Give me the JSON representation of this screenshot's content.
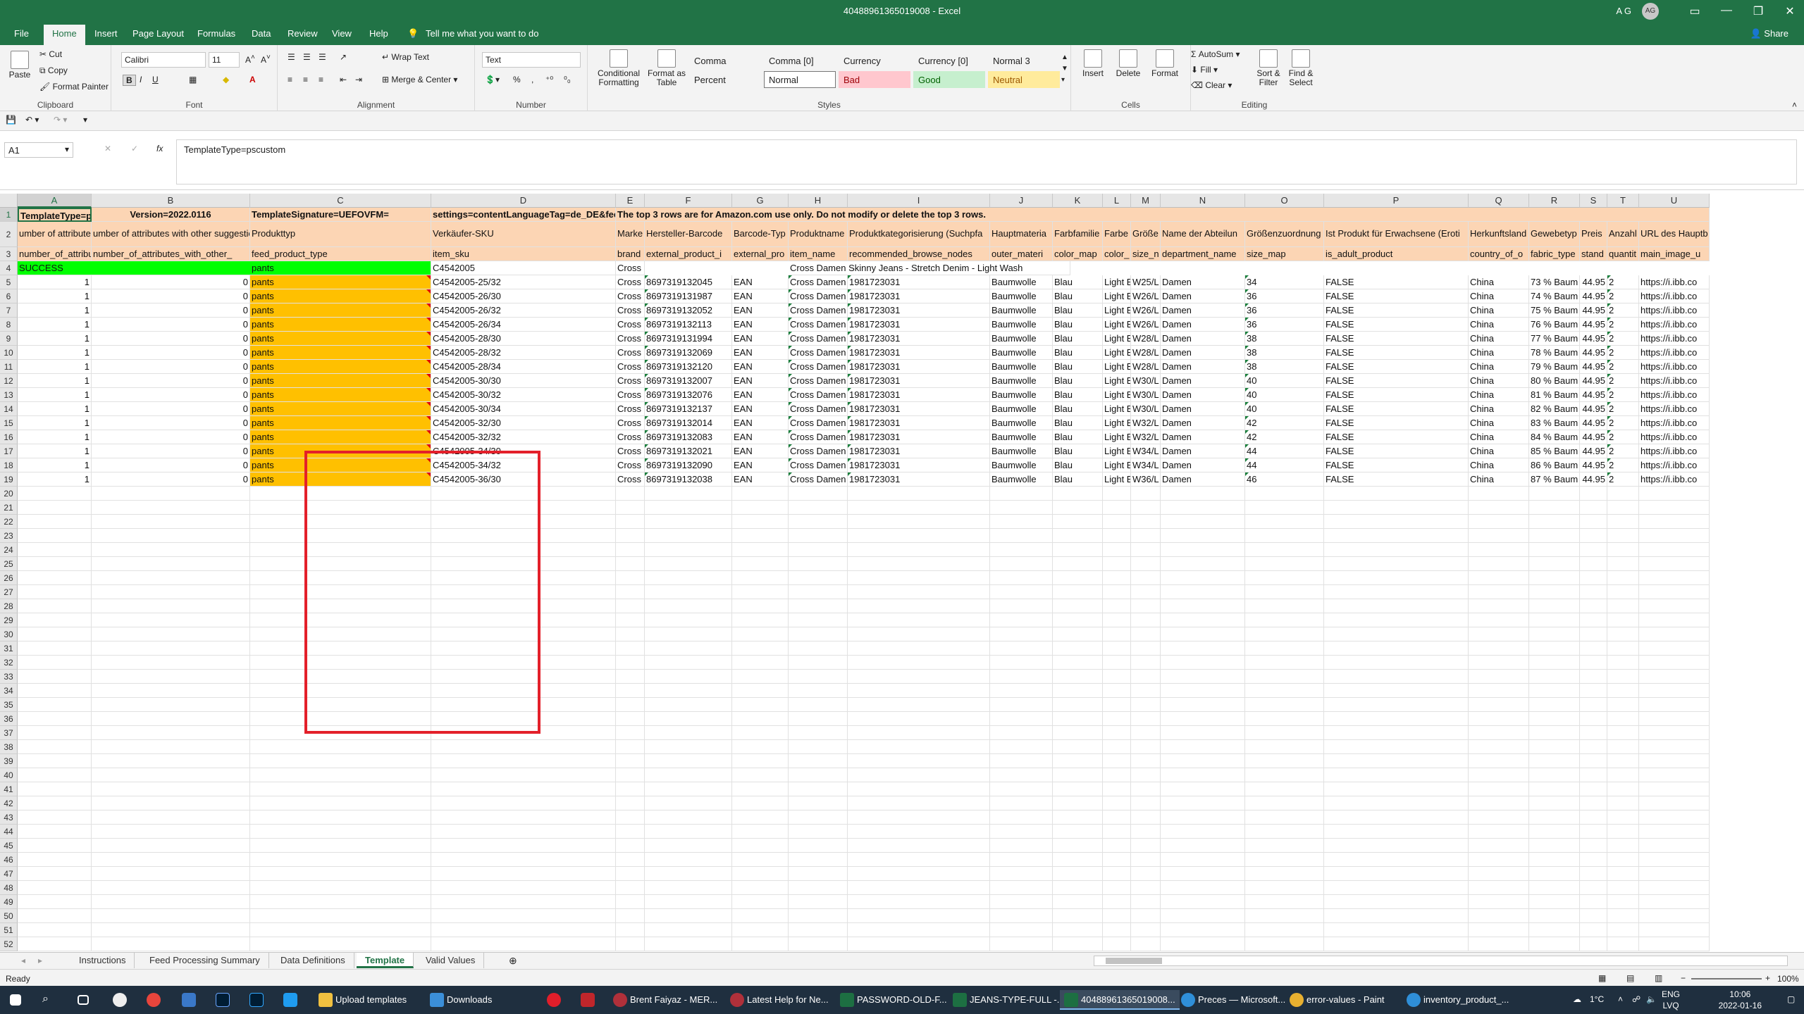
{
  "window": {
    "title": "40488961365019008 - Excel",
    "user": "A G",
    "avatar": "AG"
  },
  "ribbon_tabs": [
    "File",
    "Home",
    "Insert",
    "Page Layout",
    "Formulas",
    "Data",
    "Review",
    "View",
    "Help"
  ],
  "tell_me": "Tell me what you want to do",
  "share": "Share",
  "clipboard": {
    "paste": "Paste",
    "cut": "Cut",
    "copy": "Copy",
    "format_painter": "Format Painter",
    "label": "Clipboard"
  },
  "font": {
    "name": "Calibri",
    "size": "11",
    "label": "Font"
  },
  "alignment": {
    "wrap_text": "Wrap Text",
    "merge_center": "Merge & Center",
    "label": "Alignment"
  },
  "number": {
    "format": "Text",
    "label": "Number"
  },
  "styles": {
    "cond_format": "Conditional Formatting",
    "format_table": "Format as Table",
    "cells": [
      "Comma",
      "Comma [0]",
      "Currency",
      "Currency [0]",
      "Normal 3",
      "Percent",
      "Normal",
      "Bad",
      "Good",
      "Neutral"
    ],
    "label": "Styles"
  },
  "cells_group": {
    "insert": "Insert",
    "delete": "Delete",
    "format": "Format",
    "label": "Cells"
  },
  "editing": {
    "autosum": "AutoSum",
    "fill": "Fill",
    "clear": "Clear",
    "sort_filter": "Sort & Filter",
    "find_select": "Find & Select",
    "label": "Editing"
  },
  "namebox": "A1",
  "formula": "TemplateType=pscustom",
  "columns": [
    "A",
    "B",
    "C",
    "D",
    "E",
    "F",
    "G",
    "H",
    "I",
    "J",
    "K",
    "L",
    "M",
    "N",
    "O",
    "P",
    "Q",
    "R",
    "S",
    "T",
    "U"
  ],
  "row1": {
    "a": "TemplateType=pscustom",
    "b": "Version=2022.0116",
    "c": "TemplateSignature=UEFOVFM=",
    "d": "settings=contentLanguageTag=de_DE&fee",
    "e": "The top 3 rows are for Amazon.com use only. Do not modify or delete the top 3 rows."
  },
  "row2": [
    "umber of attributes with erro",
    "umber of attributes with other suggestio",
    "Produkttyp",
    "Verkäufer-SKU",
    "Marke",
    "Hersteller-Barcode",
    "Barcode-Typ",
    "Produktname",
    "Produktkategorisierung (Suchpfa",
    "Hauptmateria",
    "Farbfamilie",
    "Farbe",
    "Größe",
    "Name der Abteilun",
    "Größenzuordnung",
    "Ist Produkt für Erwachsene (Eroti",
    "Herkunftsland",
    "Gewebetyp",
    "Preis",
    "Anzahl",
    "URL des Hauptb"
  ],
  "row3": [
    "number_of_attributes_with_e",
    "number_of_attributes_with_other_",
    "feed_product_type",
    "item_sku",
    "brand",
    "external_product_i",
    "external_pro",
    "item_name",
    "recommended_browse_nodes",
    "outer_materi",
    "color_map",
    "color_",
    "size_n",
    "department_name",
    "size_map",
    "is_adult_product",
    "country_of_o",
    "fabric_type",
    "stand",
    "quantit",
    "main_image_u"
  ],
  "row4": {
    "status": "SUCCESS",
    "type": "pants",
    "sku": "C4542005",
    "brand": "Cross",
    "name": "Cross Damen Skinny Jeans - Stretch Denim - Light Wash"
  },
  "data_rows": [
    {
      "a": "1",
      "b": "0",
      "c": "pants",
      "d": "C4542005-25/32",
      "e": "Cross",
      "f": "8697319132045",
      "g": "EAN",
      "h": "Cross Damen",
      "i": "1981723031",
      "j": "Baumwolle",
      "k": "Blau",
      "l": "Light E",
      "m": "W25/L",
      "n": "Damen",
      "o": "34",
      "p": "FALSE",
      "q": "China",
      "r": "73 % Baum",
      "s": "44.95",
      "t": "2",
      "u": "https://i.ibb.co"
    },
    {
      "a": "1",
      "b": "0",
      "c": "pants",
      "d": "C4542005-26/30",
      "e": "Cross",
      "f": "8697319131987",
      "g": "EAN",
      "h": "Cross Damen",
      "i": "1981723031",
      "j": "Baumwolle",
      "k": "Blau",
      "l": "Light E",
      "m": "W26/L",
      "n": "Damen",
      "o": "36",
      "p": "FALSE",
      "q": "China",
      "r": "74 % Baum",
      "s": "44.95",
      "t": "2",
      "u": "https://i.ibb.co"
    },
    {
      "a": "1",
      "b": "0",
      "c": "pants",
      "d": "C4542005-26/32",
      "e": "Cross",
      "f": "8697319132052",
      "g": "EAN",
      "h": "Cross Damen",
      "i": "1981723031",
      "j": "Baumwolle",
      "k": "Blau",
      "l": "Light E",
      "m": "W26/L",
      "n": "Damen",
      "o": "36",
      "p": "FALSE",
      "q": "China",
      "r": "75 % Baum",
      "s": "44.95",
      "t": "2",
      "u": "https://i.ibb.co"
    },
    {
      "a": "1",
      "b": "0",
      "c": "pants",
      "d": "C4542005-26/34",
      "e": "Cross",
      "f": "8697319132113",
      "g": "EAN",
      "h": "Cross Damen",
      "i": "1981723031",
      "j": "Baumwolle",
      "k": "Blau",
      "l": "Light E",
      "m": "W26/L",
      "n": "Damen",
      "o": "36",
      "p": "FALSE",
      "q": "China",
      "r": "76 % Baum",
      "s": "44.95",
      "t": "2",
      "u": "https://i.ibb.co"
    },
    {
      "a": "1",
      "b": "0",
      "c": "pants",
      "d": "C4542005-28/30",
      "e": "Cross",
      "f": "8697319131994",
      "g": "EAN",
      "h": "Cross Damen",
      "i": "1981723031",
      "j": "Baumwolle",
      "k": "Blau",
      "l": "Light E",
      "m": "W28/L",
      "n": "Damen",
      "o": "38",
      "p": "FALSE",
      "q": "China",
      "r": "77 % Baum",
      "s": "44.95",
      "t": "2",
      "u": "https://i.ibb.co"
    },
    {
      "a": "1",
      "b": "0",
      "c": "pants",
      "d": "C4542005-28/32",
      "e": "Cross",
      "f": "8697319132069",
      "g": "EAN",
      "h": "Cross Damen",
      "i": "1981723031",
      "j": "Baumwolle",
      "k": "Blau",
      "l": "Light E",
      "m": "W28/L",
      "n": "Damen",
      "o": "38",
      "p": "FALSE",
      "q": "China",
      "r": "78 % Baum",
      "s": "44.95",
      "t": "2",
      "u": "https://i.ibb.co"
    },
    {
      "a": "1",
      "b": "0",
      "c": "pants",
      "d": "C4542005-28/34",
      "e": "Cross",
      "f": "8697319132120",
      "g": "EAN",
      "h": "Cross Damen",
      "i": "1981723031",
      "j": "Baumwolle",
      "k": "Blau",
      "l": "Light E",
      "m": "W28/L",
      "n": "Damen",
      "o": "38",
      "p": "FALSE",
      "q": "China",
      "r": "79 % Baum",
      "s": "44.95",
      "t": "2",
      "u": "https://i.ibb.co"
    },
    {
      "a": "1",
      "b": "0",
      "c": "pants",
      "d": "C4542005-30/30",
      "e": "Cross",
      "f": "8697319132007",
      "g": "EAN",
      "h": "Cross Damen",
      "i": "1981723031",
      "j": "Baumwolle",
      "k": "Blau",
      "l": "Light E",
      "m": "W30/L",
      "n": "Damen",
      "o": "40",
      "p": "FALSE",
      "q": "China",
      "r": "80 % Baum",
      "s": "44.95",
      "t": "2",
      "u": "https://i.ibb.co"
    },
    {
      "a": "1",
      "b": "0",
      "c": "pants",
      "d": "C4542005-30/32",
      "e": "Cross",
      "f": "8697319132076",
      "g": "EAN",
      "h": "Cross Damen",
      "i": "1981723031",
      "j": "Baumwolle",
      "k": "Blau",
      "l": "Light E",
      "m": "W30/L",
      "n": "Damen",
      "o": "40",
      "p": "FALSE",
      "q": "China",
      "r": "81 % Baum",
      "s": "44.95",
      "t": "2",
      "u": "https://i.ibb.co"
    },
    {
      "a": "1",
      "b": "0",
      "c": "pants",
      "d": "C4542005-30/34",
      "e": "Cross",
      "f": "8697319132137",
      "g": "EAN",
      "h": "Cross Damen",
      "i": "1981723031",
      "j": "Baumwolle",
      "k": "Blau",
      "l": "Light E",
      "m": "W30/L",
      "n": "Damen",
      "o": "40",
      "p": "FALSE",
      "q": "China",
      "r": "82 % Baum",
      "s": "44.95",
      "t": "2",
      "u": "https://i.ibb.co"
    },
    {
      "a": "1",
      "b": "0",
      "c": "pants",
      "d": "C4542005-32/30",
      "e": "Cross",
      "f": "8697319132014",
      "g": "EAN",
      "h": "Cross Damen",
      "i": "1981723031",
      "j": "Baumwolle",
      "k": "Blau",
      "l": "Light E",
      "m": "W32/L",
      "n": "Damen",
      "o": "42",
      "p": "FALSE",
      "q": "China",
      "r": "83 % Baum",
      "s": "44.95",
      "t": "2",
      "u": "https://i.ibb.co"
    },
    {
      "a": "1",
      "b": "0",
      "c": "pants",
      "d": "C4542005-32/32",
      "e": "Cross",
      "f": "8697319132083",
      "g": "EAN",
      "h": "Cross Damen",
      "i": "1981723031",
      "j": "Baumwolle",
      "k": "Blau",
      "l": "Light E",
      "m": "W32/L",
      "n": "Damen",
      "o": "42",
      "p": "FALSE",
      "q": "China",
      "r": "84 % Baum",
      "s": "44.95",
      "t": "2",
      "u": "https://i.ibb.co"
    },
    {
      "a": "1",
      "b": "0",
      "c": "pants",
      "d": "C4542005-34/30",
      "e": "Cross",
      "f": "8697319132021",
      "g": "EAN",
      "h": "Cross Damen",
      "i": "1981723031",
      "j": "Baumwolle",
      "k": "Blau",
      "l": "Light E",
      "m": "W34/L",
      "n": "Damen",
      "o": "44",
      "p": "FALSE",
      "q": "China",
      "r": "85 % Baum",
      "s": "44.95",
      "t": "2",
      "u": "https://i.ibb.co"
    },
    {
      "a": "1",
      "b": "0",
      "c": "pants",
      "d": "C4542005-34/32",
      "e": "Cross",
      "f": "8697319132090",
      "g": "EAN",
      "h": "Cross Damen",
      "i": "1981723031",
      "j": "Baumwolle",
      "k": "Blau",
      "l": "Light E",
      "m": "W34/L",
      "n": "Damen",
      "o": "44",
      "p": "FALSE",
      "q": "China",
      "r": "86 % Baum",
      "s": "44.95",
      "t": "2",
      "u": "https://i.ibb.co"
    },
    {
      "a": "1",
      "b": "0",
      "c": "pants",
      "d": "C4542005-36/30",
      "e": "Cross",
      "f": "8697319132038",
      "g": "EAN",
      "h": "Cross Damen",
      "i": "1981723031",
      "j": "Baumwolle",
      "k": "Blau",
      "l": "Light E",
      "m": "W36/L",
      "n": "Damen",
      "o": "46",
      "p": "FALSE",
      "q": "China",
      "r": "87 % Baum",
      "s": "44.95",
      "t": "2",
      "u": "https://i.ibb.co"
    }
  ],
  "sheet_tabs": [
    "Instructions",
    "Feed Processing Summary",
    "Data Definitions",
    "Template",
    "Valid Values"
  ],
  "active_sheet": "Template",
  "status": {
    "ready": "Ready",
    "zoom": "100%"
  },
  "taskbar": {
    "apps": [
      "Upload templates",
      "Downloads",
      "Brent Faiyaz - MER...",
      "Latest Help for Ne...",
      "PASSWORD-OLD-F...",
      "JEANS-TYPE-FULL -...",
      "40488961365019008...",
      "Preces — Microsoft...",
      "error-values - Paint",
      "inventory_product_..."
    ],
    "weather": "1°C",
    "lang": "ENG",
    "lang2": "LVQ",
    "time": "10:06",
    "date": "2022-01-16"
  }
}
